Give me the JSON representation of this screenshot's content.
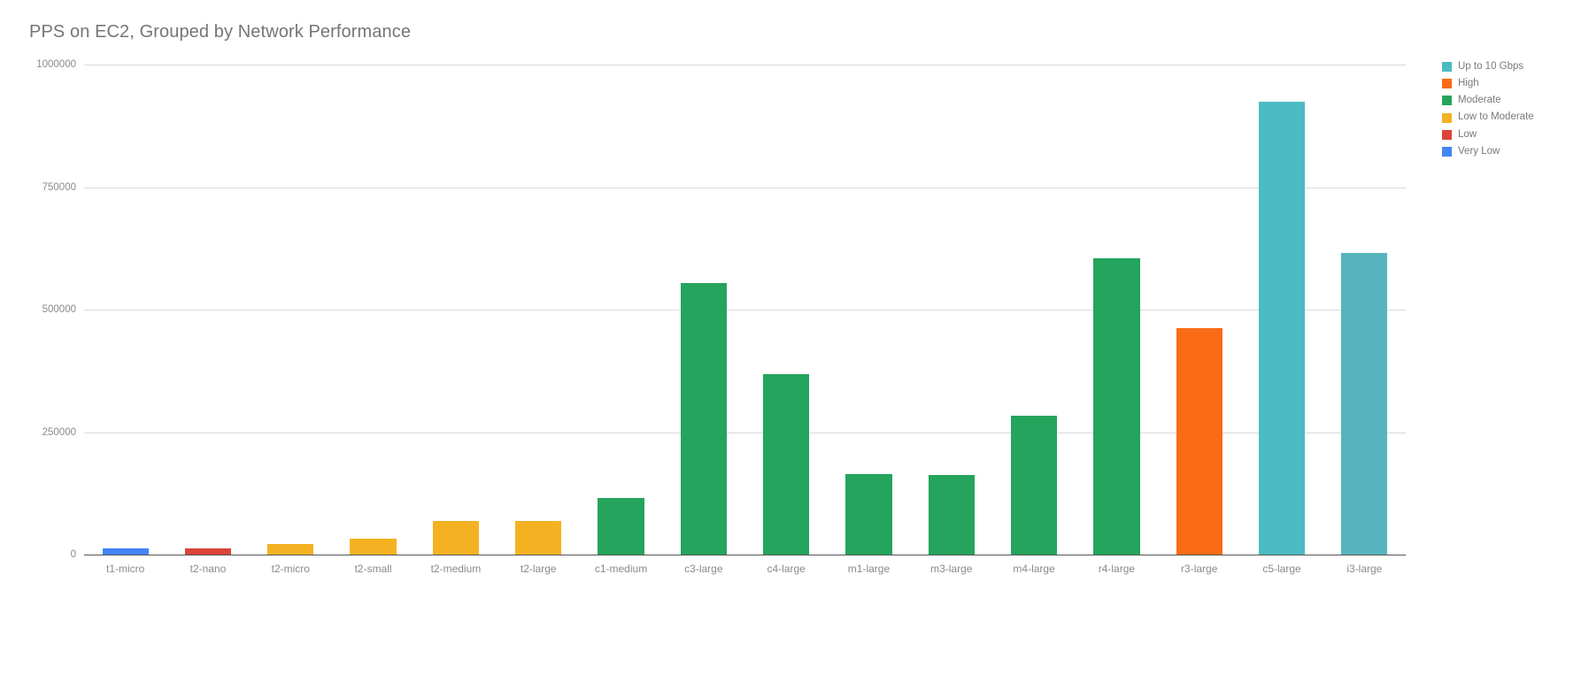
{
  "chart_data": {
    "type": "bar",
    "title": "PPS on EC2, Grouped by Network Performance",
    "xlabel": "",
    "ylabel": "",
    "ylim": [
      0,
      1000000
    ],
    "ytick_labels": [
      "1000000",
      "750000",
      "500000",
      "250000",
      "0"
    ],
    "ytick_values": [
      1000000,
      750000,
      500000,
      250000,
      0
    ],
    "grid": true,
    "legend_position": "right",
    "categories": [
      "t1-micro",
      "t2-nano",
      "t2-micro",
      "t2-small",
      "t2-medium",
      "t2-large",
      "c1-medium",
      "c3-large",
      "c4-large",
      "m1-large",
      "m3-large",
      "m4-large",
      "r4-large",
      "r3-large",
      "c5-large",
      "i3-large"
    ],
    "values": [
      12000,
      13000,
      22000,
      33000,
      68000,
      68000,
      115000,
      555000,
      368000,
      165000,
      163000,
      283000,
      605000,
      462000,
      925000,
      615000
    ],
    "group_of_category": [
      "Very Low",
      "Low",
      "Low to Moderate",
      "Low to Moderate",
      "Low to Moderate",
      "Low to Moderate",
      "Moderate",
      "Moderate",
      "Moderate",
      "Moderate",
      "Moderate",
      "Moderate",
      "Moderate",
      "High",
      "Up to 10 Gbps",
      "Up to 10 Gbps"
    ],
    "bar_colors": [
      "#4285f4",
      "#db4437",
      "#f4b223",
      "#f4b223",
      "#f4b223",
      "#f4b223",
      "#24a45c",
      "#24a45c",
      "#24a45c",
      "#24a45c",
      "#24a45c",
      "#24a45c",
      "#24a45c",
      "#fa6b15",
      "#4bbac2",
      "#57b3bd"
    ],
    "legend": [
      {
        "label": "Up to 10 Gbps",
        "color": "#4bbac2"
      },
      {
        "label": "High",
        "color": "#fa6b15"
      },
      {
        "label": "Moderate",
        "color": "#24a45c"
      },
      {
        "label": "Low to Moderate",
        "color": "#f4b223"
      },
      {
        "label": "Low",
        "color": "#db4437"
      },
      {
        "label": "Very Low",
        "color": "#4285f4"
      }
    ]
  },
  "colors": {
    "title_text": "#757575",
    "tick_text": "#8a8a8a",
    "gridline": "#d9d9d9",
    "axis_line": "#555555",
    "background": "#ffffff"
  }
}
